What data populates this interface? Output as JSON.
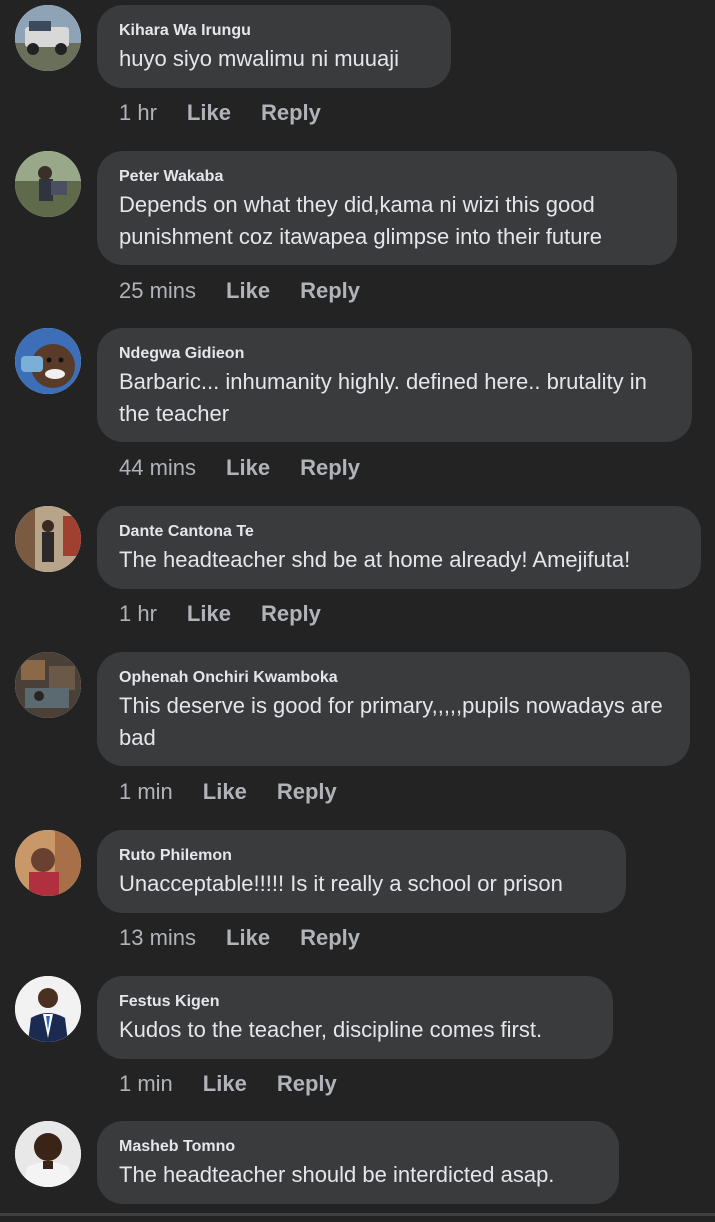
{
  "comments": [
    {
      "author": "Kihara Wa Irungu",
      "text": "huyo siyo mwalimu ni muuaji",
      "time": "1 hr",
      "like": "Like",
      "reply": "Reply"
    },
    {
      "author": "Peter Wakaba",
      "text": "Depends on what they did,kama ni wizi this good punishment coz itawapea glimpse into their future",
      "time": "25 mins",
      "like": "Like",
      "reply": "Reply"
    },
    {
      "author": "Ndegwa Gidieon",
      "text": "Barbaric... inhumanity highly. defined here.. brutality in the teacher",
      "time": "44 mins",
      "like": "Like",
      "reply": "Reply"
    },
    {
      "author": "Dante Cantona Te",
      "text": "The headteacher shd be at home already! Amejifuta!",
      "time": "1 hr",
      "like": "Like",
      "reply": "Reply"
    },
    {
      "author": "Ophenah Onchiri Kwamboka",
      "text": "This deserve is good for primary,,,,,pupils nowadays are bad",
      "time": "1 min",
      "like": "Like",
      "reply": "Reply"
    },
    {
      "author": "Ruto Philemon",
      "text": "Unacceptable!!!!! Is it really a school or prison",
      "time": "13 mins",
      "like": "Like",
      "reply": "Reply"
    },
    {
      "author": "Festus Kigen",
      "text": "Kudos to the teacher, discipline comes first.",
      "time": "1 min",
      "like": "Like",
      "reply": "Reply"
    },
    {
      "author": "Masheb Tomno",
      "text": "The headteacher should be interdicted asap.",
      "time": "",
      "like": "",
      "reply": ""
    }
  ],
  "colors": {
    "background": "#232324",
    "bubble": "#3a3b3c",
    "text_primary": "#e4e6eb",
    "text_secondary": "#b0b3b8"
  }
}
